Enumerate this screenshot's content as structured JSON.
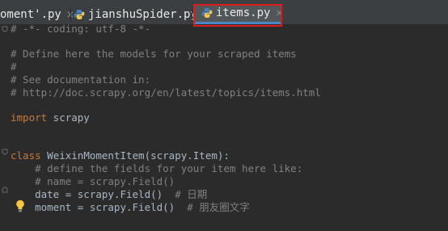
{
  "tabs": [
    {
      "label": "oment'.py",
      "active": false
    },
    {
      "label": "jianshuSpider.py",
      "active": false
    },
    {
      "label": "items.py",
      "active": true
    }
  ],
  "close_glyph": "×",
  "code": {
    "lines": [
      {
        "id": "l1",
        "segments": [
          {
            "text": "# -*- coding: utf-8 -*-",
            "kind": "comment"
          }
        ]
      },
      {
        "id": "l3",
        "segments": [
          {
            "text": "# Define here the models for your scraped items",
            "kind": "comment"
          }
        ]
      },
      {
        "id": "l4",
        "segments": [
          {
            "text": "#",
            "kind": "comment"
          }
        ]
      },
      {
        "id": "l5",
        "segments": [
          {
            "text": "# See documentation in:",
            "kind": "comment"
          }
        ]
      },
      {
        "id": "l6",
        "segments": [
          {
            "text": "# http://doc.scrapy.org/en/latest/topics/items.html",
            "kind": "comment"
          }
        ]
      },
      {
        "id": "l8",
        "segments": [
          {
            "text": "import",
            "kind": "keyword"
          },
          {
            "text": " scrapy",
            "kind": "plain"
          }
        ]
      },
      {
        "id": "l11",
        "segments": [
          {
            "text": "class",
            "kind": "keyword"
          },
          {
            "text": " WeixinMomentItem(scrapy.Item):",
            "kind": "plain"
          }
        ]
      },
      {
        "id": "l12",
        "segments": [
          {
            "text": "    # define the fields for your item here like:",
            "kind": "comment"
          }
        ]
      },
      {
        "id": "l13",
        "segments": [
          {
            "text": "    # name = scrapy.Field()",
            "kind": "comment"
          }
        ]
      },
      {
        "id": "l14",
        "segments": [
          {
            "text": "    date = scrapy.Field()  ",
            "kind": "plain"
          },
          {
            "text": "# 日期",
            "kind": "comment"
          }
        ]
      },
      {
        "id": "l15",
        "segments": [
          {
            "text": "    moment = scrapy.Field()  ",
            "kind": "plain"
          },
          {
            "text": "# 朋友圈文字",
            "kind": "comment"
          }
        ]
      }
    ]
  },
  "colors": {
    "background": "#2b2b2b",
    "tabbar": "#3c3f41",
    "active_tab": "#515658",
    "active_underline": "#4a88c7",
    "comment": "#808080",
    "keyword": "#cc7832",
    "text": "#a9b7c6",
    "highlight_box": "#e01b1b",
    "bulb": "#f4c842"
  },
  "icons": {
    "python_file": "python-file-icon",
    "close": "close-icon",
    "fold": "fold-marker-icon",
    "intention": "lightbulb-icon"
  }
}
